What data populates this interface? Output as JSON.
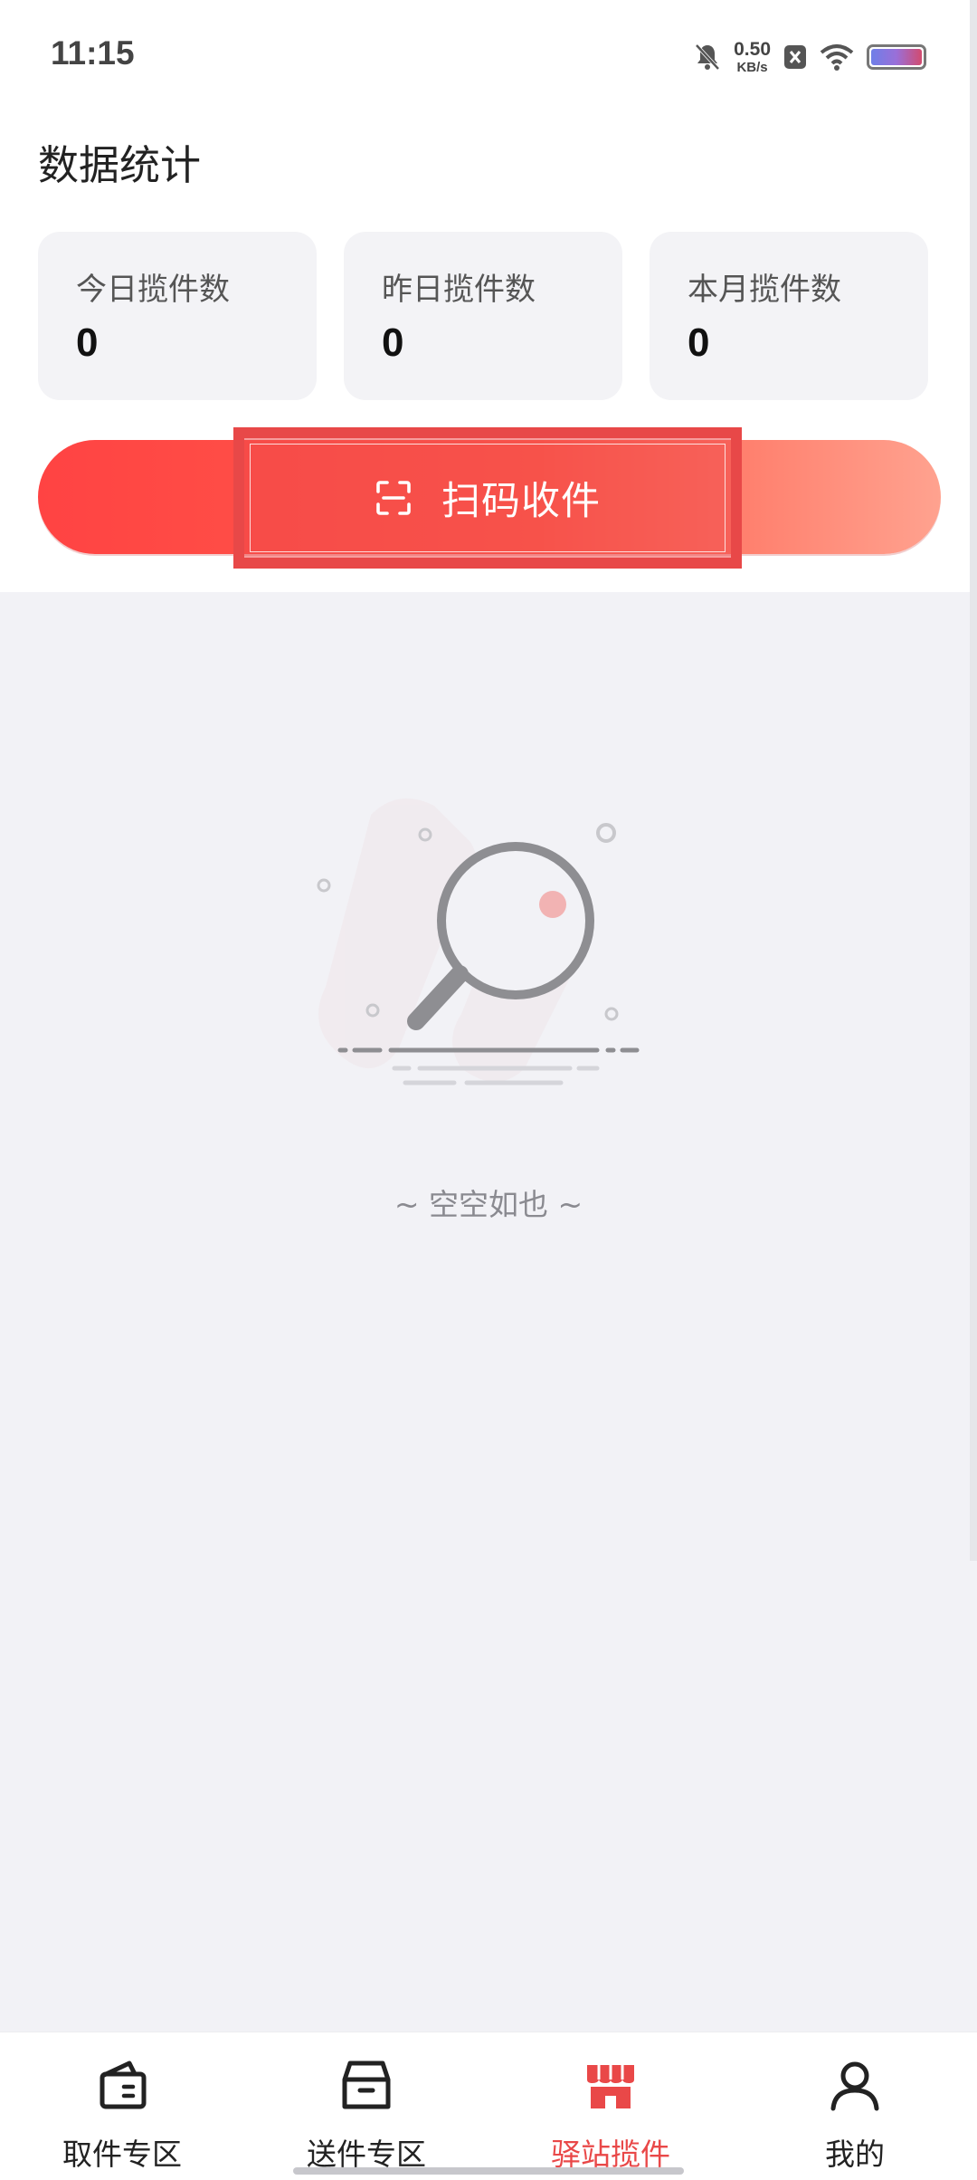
{
  "status_bar": {
    "time": "11:15",
    "net_speed_value": "0.50",
    "net_speed_unit": "KB/s",
    "icons": [
      "bell-mute-icon",
      "close-box-icon",
      "wifi-icon",
      "battery-icon"
    ]
  },
  "stats": {
    "title": "数据统计",
    "cards": [
      {
        "label": "今日揽件数",
        "value": "0"
      },
      {
        "label": "昨日揽件数",
        "value": "0"
      },
      {
        "label": "本月揽件数",
        "value": "0"
      }
    ]
  },
  "scan_button": {
    "label": "扫码收件",
    "icon": "scan-icon"
  },
  "empty_state": {
    "text": "~ 空空如也 ~",
    "icon": "magnifier-icon"
  },
  "bottom_nav": {
    "items": [
      {
        "label": "取件专区",
        "icon": "wallet-icon"
      },
      {
        "label": "送件专区",
        "icon": "box-icon"
      },
      {
        "label": "驿站揽件",
        "icon": "store-icon"
      },
      {
        "label": "我的",
        "icon": "user-icon"
      }
    ],
    "active_index": 2
  },
  "colors": {
    "accent": "#e94848",
    "scan_gradient_start": "#ff4343",
    "scan_gradient_end": "#ffa28f",
    "background": "#f2f2f6"
  }
}
